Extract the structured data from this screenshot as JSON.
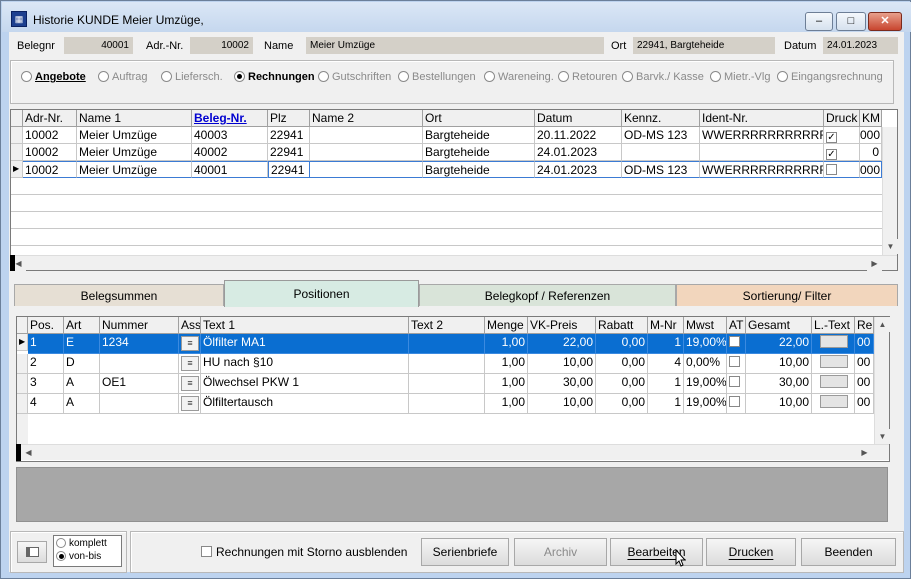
{
  "window": {
    "title": "Historie KUNDE Meier Umzüge,",
    "min": "–",
    "max": "□",
    "close": "✕"
  },
  "header": {
    "belegnr_label": "Belegnr",
    "belegnr": "40001",
    "adrnr_label": "Adr.-Nr.",
    "adrnr": "10002",
    "name_label": "Name",
    "name": "Meier Umzüge",
    "ort_label": "Ort",
    "ort": "22941, Bargteheide",
    "datum_label": "Datum",
    "datum": "24.01.2023"
  },
  "doc_types": [
    "Angebote",
    "Auftrag",
    "Liefersch.",
    "Rechnungen",
    "Gutschriften",
    "Bestellungen",
    "Wareneing.",
    "Retouren",
    "Barvk./ Kasse",
    "Mietr.-Vlg",
    "Eingangsrechnung"
  ],
  "doc_columns": [
    "Adr-Nr.",
    "Name 1",
    "Beleg-Nr.",
    "Plz",
    "Name 2",
    "Ort",
    "Datum",
    "Kennz.",
    "Ident-Nr.",
    "Druck",
    "KM"
  ],
  "doc_rows": [
    {
      "adr": "10002",
      "name1": "Meier Umzüge",
      "beleg": "40003",
      "plz": "22941",
      "name2": "",
      "ort": "Bargteheide",
      "datum": "20.11.2022",
      "kennz": "OD-MS 123",
      "ident": "WWERRRRRRRRRRRR",
      "druck": "✓",
      "km": "000"
    },
    {
      "adr": "10002",
      "name1": "Meier Umzüge",
      "beleg": "40002",
      "plz": "22941",
      "name2": "",
      "ort": "Bargteheide",
      "datum": "24.01.2023",
      "kennz": "",
      "ident": "",
      "druck": "✓",
      "km": "0"
    },
    {
      "adr": "10002",
      "name1": "Meier Umzüge",
      "beleg": "40001",
      "plz": "22941",
      "name2": "",
      "ort": "Bargteheide",
      "datum": "24.01.2023",
      "kennz": "OD-MS 123",
      "ident": "WWERRRRRRRRRRRR",
      "druck": "",
      "km": "000"
    }
  ],
  "tabs": [
    "Belegsummen",
    "Positionen",
    "Belegkopf / Referenzen",
    "Sortierung/ Filter"
  ],
  "pos_columns": [
    "Pos.",
    "Art",
    "Nummer",
    "Ass",
    "Text 1",
    "Text 2",
    "Menge",
    "VK-Preis",
    "Rabatt",
    "M-Nr",
    "Mwst",
    "AT",
    "Gesamt",
    "L.-Text",
    "Re"
  ],
  "pos_rows": [
    {
      "pos": "1",
      "art": "E",
      "nummer": "1234",
      "text1": "Ölfilter MA1",
      "text2": "",
      "menge": "1,00",
      "vk": "22,00",
      "rabatt": "0,00",
      "mnr": "1",
      "mwst": "19,00%",
      "gesamt": "22,00",
      "re": "00"
    },
    {
      "pos": "2",
      "art": "D",
      "nummer": "",
      "text1": "HU nach §10",
      "text2": "",
      "menge": "1,00",
      "vk": "10,00",
      "rabatt": "0,00",
      "mnr": "4",
      "mwst": "0,00%",
      "gesamt": "10,00",
      "re": "00"
    },
    {
      "pos": "3",
      "art": "A",
      "nummer": "OE1",
      "text1": "Ölwechsel PKW 1",
      "text2": "",
      "menge": "1,00",
      "vk": "30,00",
      "rabatt": "0,00",
      "mnr": "1",
      "mwst": "19,00%",
      "gesamt": "30,00",
      "re": "00"
    },
    {
      "pos": "4",
      "art": "A",
      "nummer": "",
      "text1": "Ölfiltertausch",
      "text2": "",
      "menge": "1,00",
      "vk": "10,00",
      "rabatt": "0,00",
      "mnr": "1",
      "mwst": "19,00%",
      "gesamt": "10,00",
      "re": "00"
    }
  ],
  "footer": {
    "komplett": "komplett",
    "vonbis": "von-bis",
    "storno_label": "Rechnungen mit Storno ausblenden",
    "serienbriefe": "Serienbriefe",
    "archiv": "Archiv",
    "bearbeiten": "Bearbeiten",
    "drucken": "Drucken",
    "beenden": "Beenden"
  }
}
